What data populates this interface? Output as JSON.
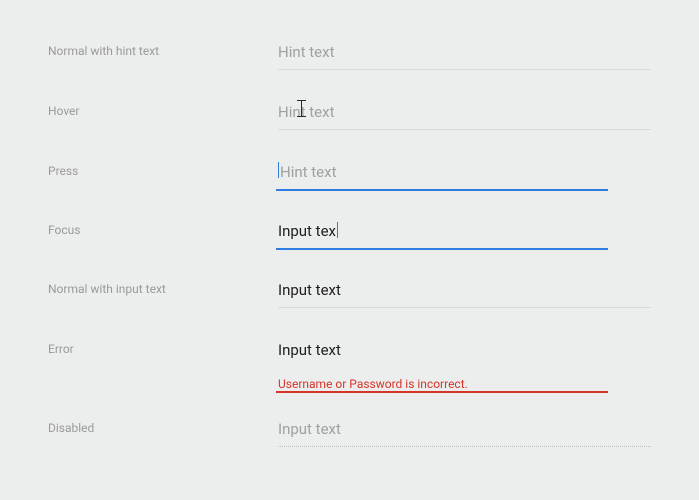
{
  "rows": {
    "normal_hint": {
      "label": "Normal with hint text",
      "placeholder": "Hint text"
    },
    "hover": {
      "label": "Hover",
      "placeholder": "Hint text"
    },
    "press": {
      "label": "Press",
      "placeholder": "Hint text"
    },
    "focus": {
      "label": "Focus",
      "value": "Input tex"
    },
    "normal_input": {
      "label": "Normal with input text",
      "value": "Input text"
    },
    "error": {
      "label": "Error",
      "value": "Input text",
      "message": "Username or Password is incorrect."
    },
    "disabled": {
      "label": "Disabled",
      "value": "Input text"
    }
  },
  "colors": {
    "focus": "#2f7de1",
    "error": "#d63429",
    "placeholder": "#9fa0a0",
    "text": "#202020"
  }
}
